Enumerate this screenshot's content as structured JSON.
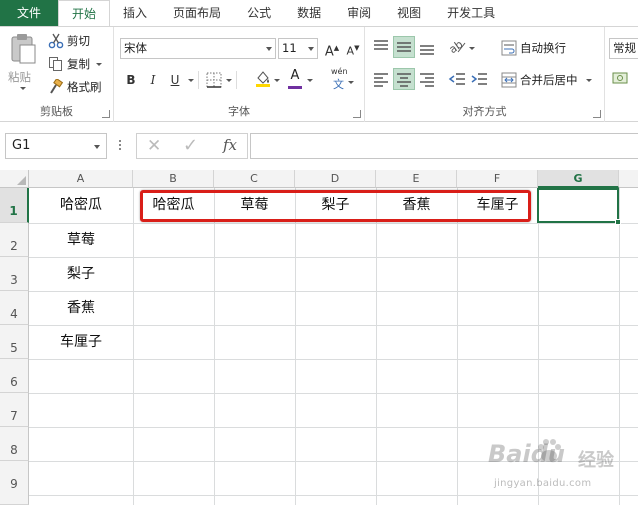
{
  "tabs": [
    "文件",
    "开始",
    "插入",
    "页面布局",
    "公式",
    "数据",
    "审阅",
    "视图",
    "开发工具"
  ],
  "clipboard": {
    "paste_label": "粘贴",
    "cut_label": "剪切",
    "copy_label": "复制",
    "format_painter_label": "格式刷",
    "group_label": "剪贴板"
  },
  "font": {
    "font_name": "宋体",
    "font_size": "11",
    "grow_label": "A",
    "shrink_label": "A",
    "bold_label": "B",
    "italic_label": "I",
    "underline_label": "U",
    "font_color_label": "A",
    "phonetic_label": "wén",
    "group_label": "字体"
  },
  "alignment": {
    "wrap_text_label": "自动换行",
    "merge_center_label": "合并后居中",
    "group_label": "对齐方式"
  },
  "number": {
    "format_value": "常规"
  },
  "formula_bar": {
    "name_box": "G1",
    "fx_label": "fx",
    "cancel_glyph": "✕",
    "enter_glyph": "✓",
    "formula_value": ""
  },
  "grid": {
    "columns": [
      "A",
      "B",
      "C",
      "D",
      "E",
      "F",
      "G"
    ],
    "rows": [
      "1",
      "2",
      "3",
      "4",
      "5",
      "6",
      "7",
      "8",
      "9"
    ],
    "selected_cell": "G1",
    "column_a": [
      "哈密瓜",
      "草莓",
      "梨子",
      "香蕉",
      "车厘子"
    ],
    "row_1_b_to_f": [
      "哈密瓜",
      "草莓",
      "梨子",
      "香蕉",
      "车厘子"
    ]
  },
  "colors": {
    "accent": "#217346",
    "highlight_box": "#d91e18"
  },
  "watermark": {
    "logo": "Baidu",
    "jingyan": "经验",
    "url": "jingyan.baidu.com"
  }
}
